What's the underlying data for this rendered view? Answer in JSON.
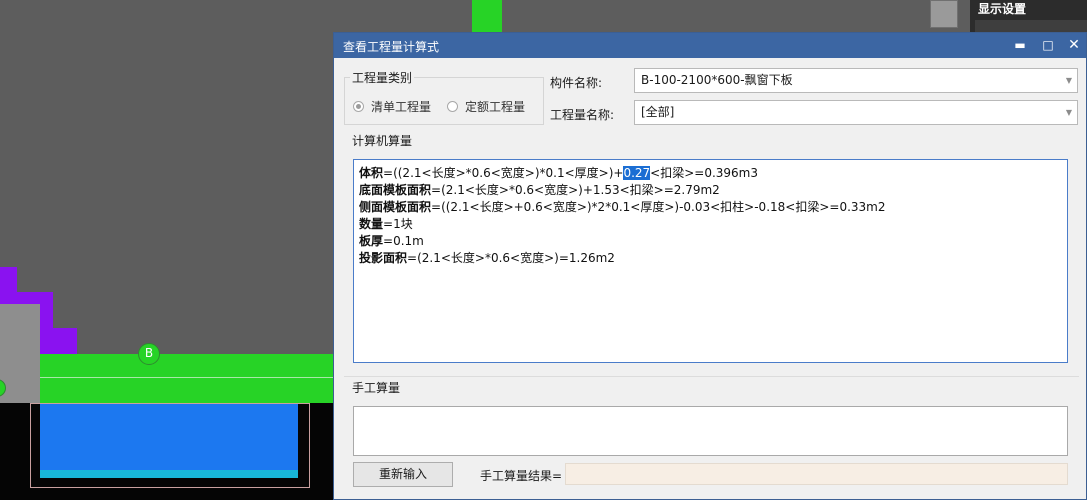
{
  "dialog": {
    "title": "查看工程量计算式",
    "controls": {
      "minimize": "▬",
      "maximize": "□",
      "close": "✕"
    }
  },
  "quantity_type": {
    "group_label": "工程量类别",
    "options": [
      {
        "label": "清单工程量",
        "selected": true
      },
      {
        "label": "定额工程量",
        "selected": false
      }
    ]
  },
  "component": {
    "label": "构件名称:",
    "value": "B-100-2100*600-飘窗下板"
  },
  "quantity_name": {
    "label": "工程量名称:",
    "value": "[全部]"
  },
  "computer_calc": {
    "label": "计算机算量",
    "lines": [
      {
        "name": "体积",
        "pre": "=((2.1<长度>*0.6<宽度>)*0.1<厚度>)+",
        "highlight": "0.27",
        "post": "<扣梁>=0.396m3"
      },
      {
        "name": "底面模板面积",
        "pre": "=(2.1<长度>*0.6<宽度>)+1.53<扣梁>=2.79m2",
        "highlight": "",
        "post": ""
      },
      {
        "name": "侧面模板面积",
        "pre": "=((2.1<长度>+0.6<宽度>)*2*0.1<厚度>)-0.03<扣柱>-0.18<扣梁>=0.33m2",
        "highlight": "",
        "post": ""
      },
      {
        "name": "数量",
        "pre": "=1块",
        "highlight": "",
        "post": ""
      },
      {
        "name": "板厚",
        "pre": "=0.1m",
        "highlight": "",
        "post": ""
      },
      {
        "name": "投影面积",
        "pre": "=(2.1<长度>*0.6<宽度>)=1.26m2",
        "highlight": "",
        "post": ""
      }
    ]
  },
  "manual_calc": {
    "label": "手工算量",
    "input_value": "",
    "reenter_button": "重新输入",
    "result_label": "手工算量结果=",
    "result_value": ""
  },
  "background": {
    "side_panel_title": "显示设置",
    "grid_marker": "B"
  }
}
